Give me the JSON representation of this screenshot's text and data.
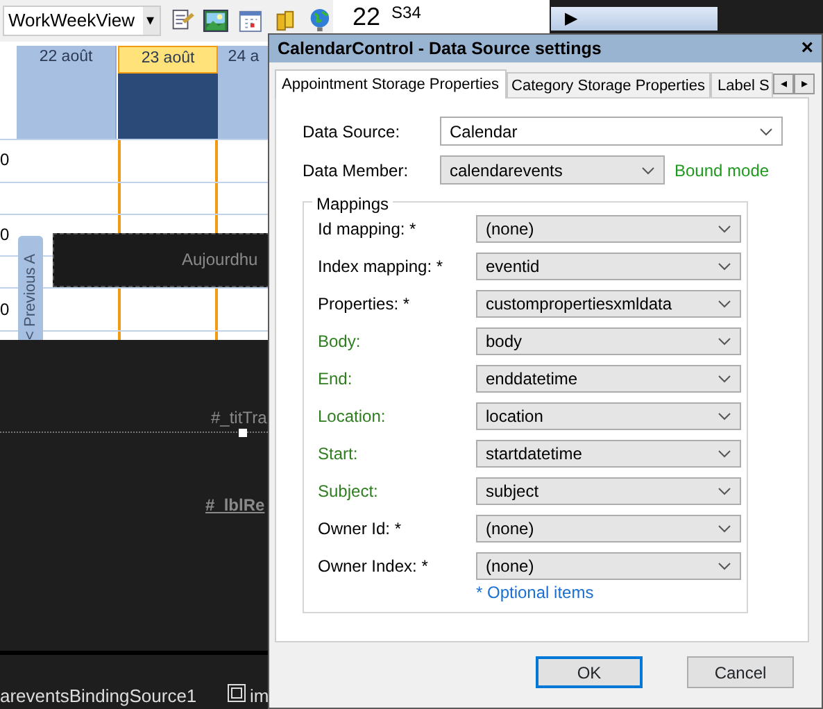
{
  "toolbar": {
    "view_select": "WorkWeekView",
    "dropdown_arrow": "▾",
    "week_field": {
      "year": "22",
      "week": "S34"
    },
    "nav_arrow": "▶"
  },
  "calendar": {
    "days": [
      {
        "label": "22 août",
        "selected": false
      },
      {
        "label": "23 août",
        "selected": true
      },
      {
        "label": "24 a",
        "selected": false
      }
    ],
    "time_labels": [
      "0",
      "0",
      "0"
    ],
    "today_bar": "Aujourdhu",
    "side_tab": "Previous A",
    "side_tab_arrow": "<"
  },
  "designer": {
    "labels": [
      {
        "text": "#_titTra",
        "kind": "plain"
      },
      {
        "text": "#_lblRe",
        "kind": "bold"
      }
    ],
    "tray": [
      {
        "text": "areventsBindingSource1",
        "kind": "text"
      },
      {
        "text": "im",
        "kind": "icon"
      }
    ]
  },
  "dialog": {
    "title": "CalendarControl - Data Source settings",
    "close": "×",
    "tabs": [
      {
        "label": "Appointment Storage Properties",
        "selected": true
      },
      {
        "label": "Category Storage Properties",
        "selected": false
      },
      {
        "label": "Label S",
        "selected": false
      }
    ],
    "tab_scroll": [
      "◂",
      "▸"
    ],
    "data_source": {
      "label": "Data Source:",
      "value": "Calendar"
    },
    "data_member": {
      "label": "Data Member:",
      "value": "calendarevents",
      "status": "Bound mode"
    },
    "mappings": {
      "title": "Mappings",
      "rows": [
        {
          "label": "Id mapping: *",
          "value": "(none)",
          "color": "#000000"
        },
        {
          "label": "Index mapping: *",
          "value": "eventid",
          "color": "#000000"
        },
        {
          "label": "Properties: *",
          "value": "custompropertiesxmldata",
          "color": "#000000"
        },
        {
          "label": "Body:",
          "value": "body",
          "color": "#2e7d1e"
        },
        {
          "label": "End:",
          "value": "enddatetime",
          "color": "#2e7d1e"
        },
        {
          "label": "Location:",
          "value": "location",
          "color": "#2e7d1e"
        },
        {
          "label": "Start:",
          "value": "startdatetime",
          "color": "#2e7d1e"
        },
        {
          "label": "Subject:",
          "value": "subject",
          "color": "#2e7d1e"
        },
        {
          "label": "Owner Id: *",
          "value": "(none)",
          "color": "#000000"
        },
        {
          "label": "Owner Index: *",
          "value": "(none)",
          "color": "#000000"
        }
      ],
      "note": "* Optional items"
    },
    "buttons": [
      {
        "label": "OK",
        "default": true
      },
      {
        "label": "Cancel",
        "default": false
      }
    ]
  }
}
